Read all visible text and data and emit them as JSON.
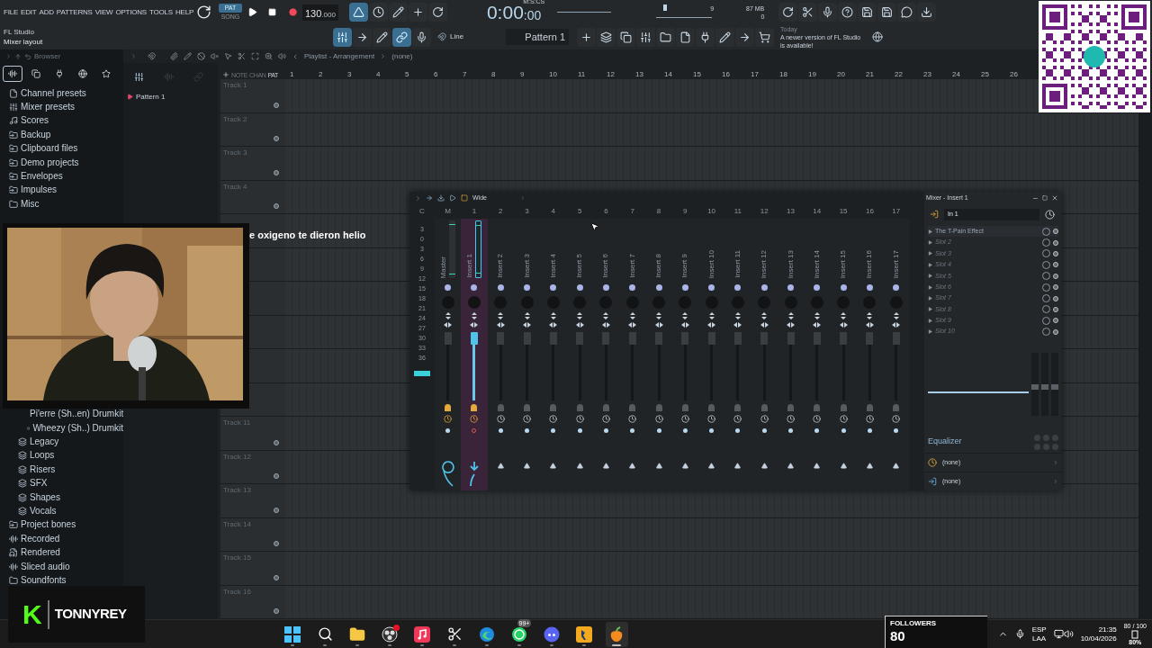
{
  "menu": [
    "FILE",
    "EDIT",
    "ADD",
    "PATTERNS",
    "VIEW",
    "OPTIONS",
    "TOOLS",
    "HELP"
  ],
  "hint": {
    "title": "FL Studio",
    "text": "Mixer layout"
  },
  "transport": {
    "modes": [
      {
        "label": "PAT",
        "selected": true
      },
      {
        "label": "SONG",
        "selected": false
      }
    ],
    "tempo": "130",
    "tempo_fraction": ".000",
    "time": "0:00",
    "time_fraction": ":00",
    "time_unit": "M:S:CS"
  },
  "monitor": {
    "cpu": "9",
    "memory": "87 MB",
    "polyphony": "0"
  },
  "tools": {
    "snap": "Line",
    "pattern": "Pattern 1"
  },
  "news": {
    "when": "Today",
    "text": "A newer version of FL Studio is available!"
  },
  "browser": {
    "title": "Browser",
    "tabs": [
      {
        "kind": "audio",
        "selected": true
      },
      {
        "kind": "files",
        "selected": false
      },
      {
        "kind": "plugin",
        "selected": false
      },
      {
        "kind": "web",
        "selected": false
      },
      {
        "kind": "star",
        "selected": false
      }
    ],
    "items": [
      {
        "label": "Channel presets",
        "kind": "channel-preset"
      },
      {
        "label": "Mixer presets",
        "kind": "mixer-preset"
      },
      {
        "label": "Scores",
        "kind": "score"
      },
      {
        "label": "Backup",
        "kind": "backup"
      },
      {
        "label": "Clipboard files",
        "kind": "folder"
      },
      {
        "label": "Demo projects",
        "kind": "folder"
      },
      {
        "label": "Envelopes",
        "kind": "folder"
      },
      {
        "label": "Impulses",
        "kind": "folder"
      },
      {
        "label": "Misc",
        "kind": "plain-folder"
      }
    ],
    "lower_items": [
      {
        "kind": "pack",
        "children": [
          {
            "kind": "pack",
            "children": [
              {
                "label": "Pi'erre (Sh..en) Drumkit",
                "kind": "pack"
              },
              {
                "label": "Wheezy (Sh..) Drumkit",
                "kind": "pack"
              }
            ]
          },
          {
            "label": "Legacy",
            "kind": "pack"
          },
          {
            "label": "Loops",
            "kind": "pack"
          },
          {
            "label": "Risers",
            "kind": "pack"
          },
          {
            "label": "SFX",
            "kind": "pack"
          },
          {
            "label": "Shapes",
            "kind": "pack"
          },
          {
            "label": "Vocals",
            "kind": "pack"
          }
        ]
      },
      {
        "label": "Project bones",
        "kind": "folder"
      },
      {
        "label": "Recorded",
        "kind": "audio"
      },
      {
        "label": "Rendered",
        "kind": "rendered"
      },
      {
        "label": "Sliced audio",
        "kind": "audio"
      },
      {
        "label": "Soundfonts",
        "kind": "plain-folder"
      }
    ]
  },
  "playlist": {
    "title": "Playlist - Arrangement",
    "pattern_name": "(none)",
    "header_labels": [
      "NOTE",
      "CHAN",
      "PAT"
    ],
    "patterns": [
      "Pattern 1"
    ],
    "bars": [
      "1",
      "2",
      "3",
      "4",
      "5",
      "6",
      "7",
      "8",
      "9",
      "10",
      "11",
      "12",
      "13",
      "14",
      "15",
      "16",
      "17",
      "18",
      "19",
      "20",
      "21",
      "22",
      "23",
      "24",
      "25",
      "26"
    ],
    "tracks_upper": [
      "Track 1",
      "Track 2",
      "Track 3",
      "Track 4"
    ],
    "tracks_lower": [
      "Track 11",
      "Track 12",
      "Track 13",
      "Track 14",
      "Track 15",
      "Track 16"
    ]
  },
  "mixer": {
    "toolbar_label": "Wide",
    "meter_label": "C",
    "meter_scale": [
      "3",
      "0",
      "3",
      "6",
      "9",
      "12",
      "15",
      "18",
      "21",
      "24",
      "27",
      "30",
      "33",
      "36"
    ],
    "channels": [
      {
        "header": "M",
        "name": "Master",
        "kind": "master",
        "selected": false
      },
      {
        "header": "1",
        "name": "Insert 1",
        "kind": "insert",
        "selected": true
      },
      {
        "header": "2",
        "name": "Insert 2",
        "kind": "insert",
        "selected": false
      },
      {
        "header": "3",
        "name": "Insert 3",
        "kind": "insert",
        "selected": false
      },
      {
        "header": "4",
        "name": "Insert 4",
        "kind": "insert",
        "selected": false
      },
      {
        "header": "5",
        "name": "Insert 5",
        "kind": "insert",
        "selected": false
      },
      {
        "header": "6",
        "name": "Insert 6",
        "kind": "insert",
        "selected": false
      },
      {
        "header": "7",
        "name": "Insert 7",
        "kind": "insert",
        "selected": false
      },
      {
        "header": "8",
        "name": "Insert 8",
        "kind": "insert",
        "selected": false
      },
      {
        "header": "9",
        "name": "Insert 9",
        "kind": "insert",
        "selected": false
      },
      {
        "header": "10",
        "name": "Insert 10",
        "kind": "insert",
        "selected": false
      },
      {
        "header": "11",
        "name": "Insert 11",
        "kind": "insert",
        "selected": false
      },
      {
        "header": "12",
        "name": "Insert 12",
        "kind": "insert",
        "selected": false
      },
      {
        "header": "13",
        "name": "Insert 13",
        "kind": "insert",
        "selected": false
      },
      {
        "header": "14",
        "name": "Insert 14",
        "kind": "insert",
        "selected": false
      },
      {
        "header": "15",
        "name": "Insert 15",
        "kind": "insert",
        "selected": false
      },
      {
        "header": "16",
        "name": "Insert 16",
        "kind": "insert",
        "selected": false
      },
      {
        "header": "17",
        "name": "Insert 17",
        "kind": "insert",
        "selected": false
      }
    ],
    "panel": {
      "title": "Mixer - Insert 1",
      "input": "In 1",
      "slots": [
        {
          "name": "The T-Pain Effect",
          "filled": true
        },
        {
          "name": "Slot 2",
          "filled": false
        },
        {
          "name": "Slot 3",
          "filled": false
        },
        {
          "name": "Slot 4",
          "filled": false
        },
        {
          "name": "Slot 5",
          "filled": false
        },
        {
          "name": "Slot 6",
          "filled": false
        },
        {
          "name": "Slot 7",
          "filled": false
        },
        {
          "name": "Slot 8",
          "filled": false
        },
        {
          "name": "Slot 9",
          "filled": false
        },
        {
          "name": "Slot 10",
          "filled": false
        }
      ],
      "equalizer": "Equalizer",
      "eq_bands": [
        {
          "level": 0.45
        },
        {
          "level": 0.45
        },
        {
          "level": 0.45
        }
      ],
      "routes": [
        "(none)",
        "(none)"
      ]
    }
  },
  "caption": "e oxigeno te dieron helio",
  "streamer": {
    "logo": "K",
    "name": "TONNYREY"
  },
  "followers": {
    "label": "FOLLOWERS",
    "count": "80"
  },
  "taskbar": {
    "apps": [
      {
        "kind": "start",
        "selected": false
      },
      {
        "kind": "search",
        "selected": false
      },
      {
        "kind": "files",
        "selected": false
      },
      {
        "kind": "obs",
        "selected": false
      },
      {
        "kind": "music",
        "selected": false
      },
      {
        "kind": "snip",
        "selected": false
      },
      {
        "kind": "edge",
        "selected": false
      },
      {
        "kind": "whatsapp",
        "selected": false,
        "badge": "99+"
      },
      {
        "kind": "discord",
        "selected": false
      },
      {
        "kind": "game",
        "selected": false
      },
      {
        "kind": "fl",
        "selected": true
      }
    ],
    "tray": {
      "language": "ESP",
      "layout": "LAA",
      "time": "21:35",
      "date": "10/04/2026",
      "battery": "80%",
      "battery_detail": "80 / 100"
    }
  }
}
